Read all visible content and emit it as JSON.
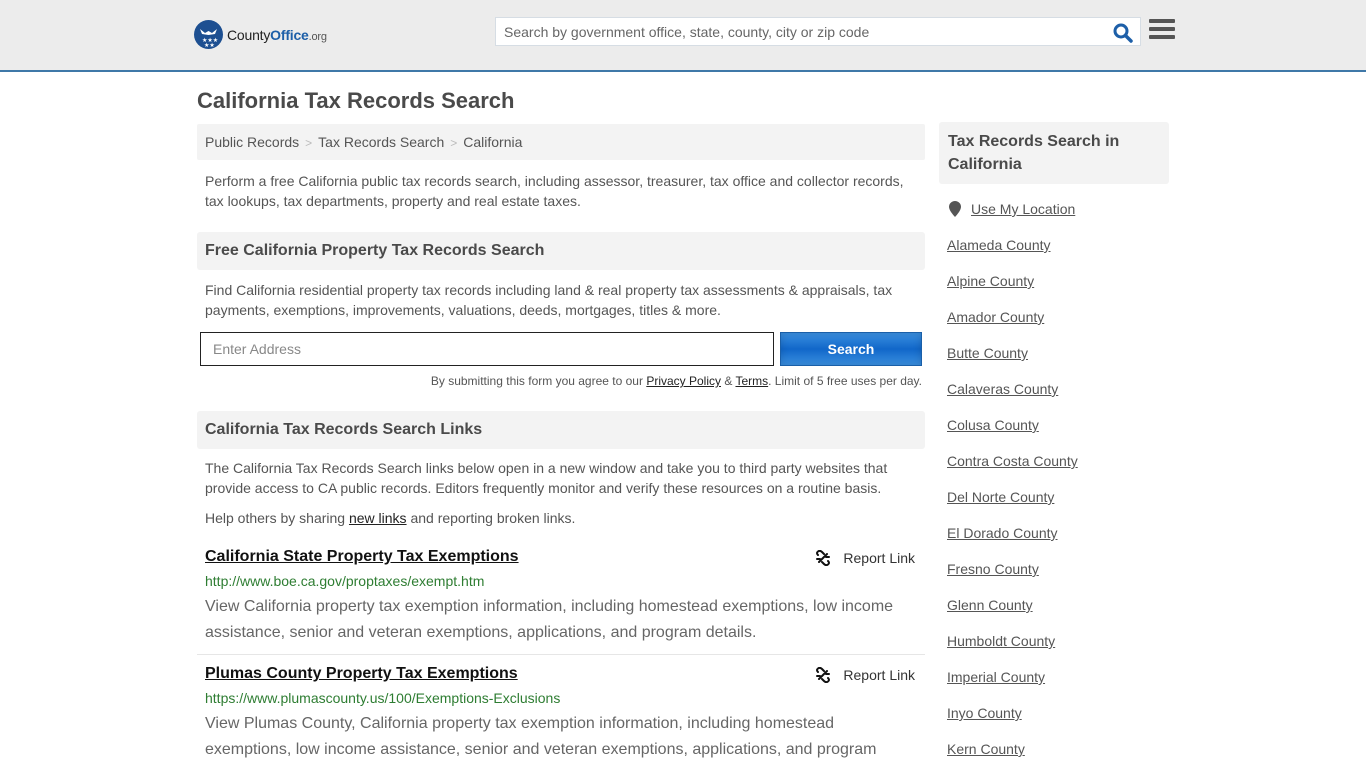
{
  "header": {
    "logo": {
      "name_part1": "County",
      "name_part2": "Office",
      "tld": ".org"
    },
    "search": {
      "placeholder": "Search by government office, state, county, city or zip code",
      "value": ""
    },
    "icons": {
      "search": "search-icon",
      "menu": "hamburger-menu-icon"
    }
  },
  "page": {
    "title": "California Tax Records Search",
    "breadcrumb": [
      {
        "label": "Public Records"
      },
      {
        "label": "Tax Records Search"
      },
      {
        "label": "California"
      }
    ],
    "breadcrumb_separator": ">",
    "intro": "Perform a free California public tax records search, including assessor, treasurer, tax office and collector records, tax lookups, tax departments, property and real estate taxes."
  },
  "property_search": {
    "heading": "Free California Property Tax Records Search",
    "description": "Find California residential property tax records including land & real property tax assessments & appraisals, tax payments, exemptions, improvements, valuations, deeds, mortgages, titles & more.",
    "address_placeholder": "Enter Address",
    "address_value": "",
    "button_label": "Search",
    "disclaimer_prefix": "By submitting this form you agree to our ",
    "privacy_label": "Privacy Policy",
    "amp": " & ",
    "terms_label": "Terms",
    "disclaimer_suffix": ". Limit of 5 free uses per day."
  },
  "links_section": {
    "heading": "California Tax Records Search Links",
    "description": "The California Tax Records Search links below open in a new window and take you to third party websites that provide access to CA public records. Editors frequently monitor and verify these resources on a routine basis.",
    "help_prefix": "Help others by sharing ",
    "help_link": "new links",
    "help_suffix": " and reporting broken links.",
    "report_label": "Report Link",
    "items": [
      {
        "title": "California State Property Tax Exemptions",
        "url": "http://www.boe.ca.gov/proptaxes/exempt.htm",
        "description": "View California property tax exemption information, including homestead exemptions, low income assistance, senior and veteran exemptions, applications, and program details."
      },
      {
        "title": "Plumas County Property Tax Exemptions",
        "url": "https://www.plumascounty.us/100/Exemptions-Exclusions",
        "description": "View Plumas County, California property tax exemption information, including homestead exemptions, low income assistance, senior and veteran exemptions, applications, and program"
      }
    ]
  },
  "sidebar": {
    "heading": "Tax Records Search in California",
    "use_location": "Use My Location",
    "counties": [
      "Alameda County",
      "Alpine County",
      "Amador County",
      "Butte County",
      "Calaveras County",
      "Colusa County",
      "Contra Costa County",
      "Del Norte County",
      "El Dorado County",
      "Fresno County",
      "Glenn County",
      "Humboldt County",
      "Imperial County",
      "Inyo County",
      "Kern County"
    ]
  },
  "colors": {
    "brand_blue": "#1d4f91",
    "header_border": "#3f78a8",
    "button_blue": "#1167c9",
    "url_green": "#2e7d32"
  }
}
